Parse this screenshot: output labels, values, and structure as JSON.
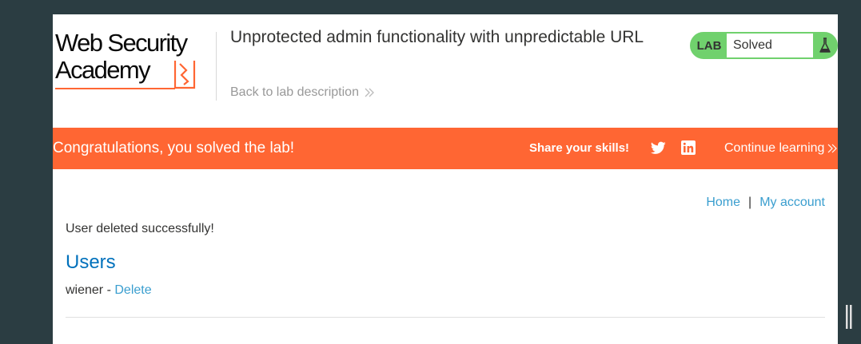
{
  "header": {
    "logo_line1": "Web Security",
    "logo_line2": "Academy",
    "lab_title": "Unprotected admin functionality with unpredictable URL",
    "back_link_label": "Back to lab description",
    "lab_status_label": "LAB",
    "lab_status_value": "Solved"
  },
  "banner": {
    "message": "Congratulations, you solved the lab!",
    "share_label": "Share your skills!",
    "continue_label": "Continue learning"
  },
  "nav": {
    "home_label": "Home",
    "separator": "|",
    "account_label": "My account"
  },
  "main": {
    "status_message": "User deleted successfully!",
    "users_heading": "Users",
    "users": [
      {
        "username": "wiener",
        "separator": " - ",
        "action_label": "Delete"
      }
    ]
  },
  "icons": {
    "back": "double-chevron-right-icon",
    "status": "flask-icon",
    "twitter": "twitter-icon",
    "linkedin": "linkedin-icon",
    "continue": "double-chevron-right-icon"
  },
  "colors": {
    "background": "#2b3d42",
    "accent_orange": "#ff6633",
    "solved_green": "#70d16d",
    "link_blue": "#3a9ecf",
    "heading_blue": "#0071bc"
  }
}
